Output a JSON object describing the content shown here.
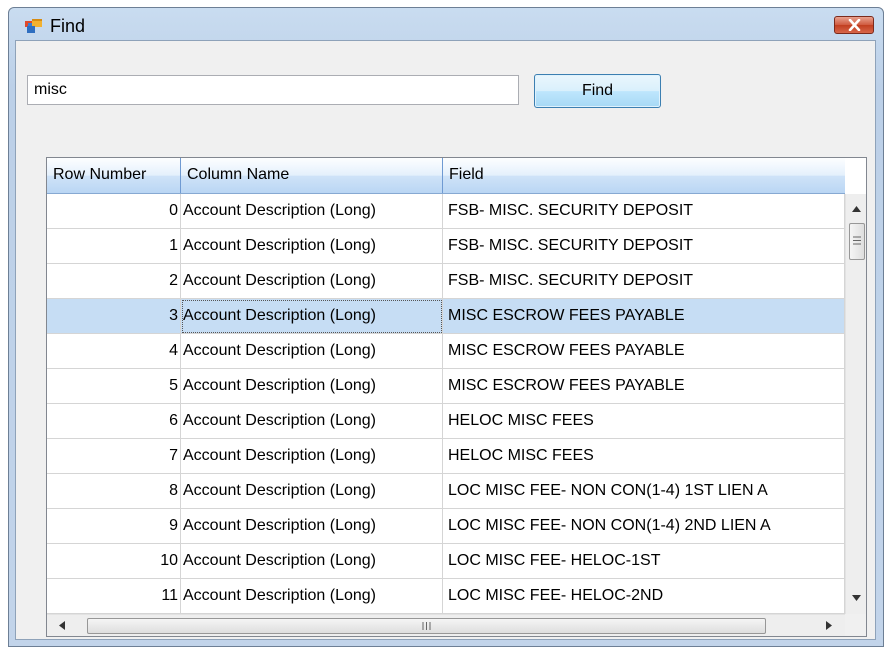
{
  "window": {
    "title": "Find"
  },
  "search": {
    "value": "misc",
    "button_label": "Find"
  },
  "grid": {
    "columns": [
      "Row Number",
      "Column Name",
      "Field"
    ],
    "rows": [
      {
        "row_number": "0",
        "column_name": "Account Description (Long)",
        "field": "FSB- MISC. SECURITY DEPOSIT"
      },
      {
        "row_number": "1",
        "column_name": "Account Description (Long)",
        "field": "FSB- MISC. SECURITY DEPOSIT"
      },
      {
        "row_number": "2",
        "column_name": "Account Description (Long)",
        "field": "FSB- MISC. SECURITY DEPOSIT"
      },
      {
        "row_number": "3",
        "column_name": "Account Description (Long)",
        "field": "MISC ESCROW FEES PAYABLE"
      },
      {
        "row_number": "4",
        "column_name": "Account Description (Long)",
        "field": "MISC ESCROW FEES PAYABLE"
      },
      {
        "row_number": "5",
        "column_name": "Account Description (Long)",
        "field": "MISC ESCROW FEES PAYABLE"
      },
      {
        "row_number": "6",
        "column_name": "Account Description (Long)",
        "field": "HELOC MISC FEES"
      },
      {
        "row_number": "7",
        "column_name": "Account Description (Long)",
        "field": "HELOC MISC FEES"
      },
      {
        "row_number": "8",
        "column_name": "Account Description (Long)",
        "field": "LOC MISC FEE- NON CON(1-4) 1ST LIEN A"
      },
      {
        "row_number": "9",
        "column_name": "Account Description (Long)",
        "field": "LOC MISC FEE- NON CON(1-4) 2ND LIEN A"
      },
      {
        "row_number": "10",
        "column_name": "Account Description (Long)",
        "field": "LOC MISC FEE- HELOC-1ST"
      },
      {
        "row_number": "11",
        "column_name": "Account Description (Long)",
        "field": "LOC MISC FEE- HELOC-2ND"
      }
    ],
    "selected_row": 3
  },
  "colors": {
    "selection": "#c6ddf4",
    "close_button": "#c13e20",
    "window_frame": "#c2d4ea"
  },
  "icons": {
    "app": "app-window-icon",
    "close": "close-icon",
    "scroll_up": "arrow-up-icon",
    "scroll_down": "arrow-down-icon",
    "scroll_left": "arrow-left-icon",
    "scroll_right": "arrow-right-icon",
    "thumb_grip": "grip-icon"
  }
}
